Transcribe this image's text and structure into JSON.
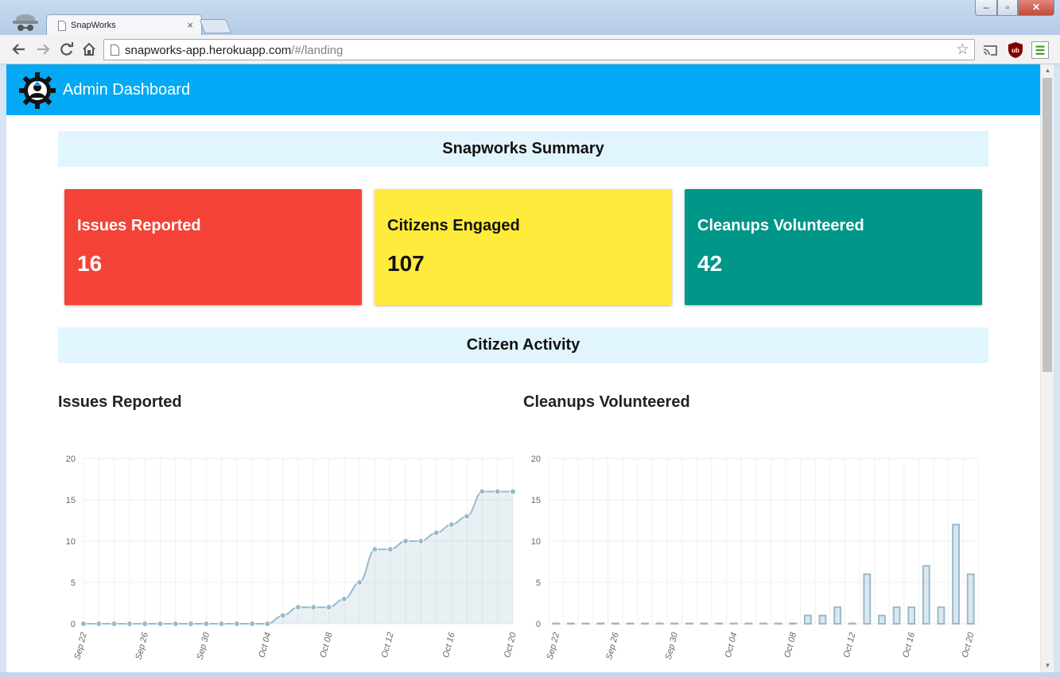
{
  "browser": {
    "tab_title": "SnapWorks",
    "tab_close": "×",
    "url_host": "snapworks-app.herokuapp.com",
    "url_path": "/#/landing",
    "nav_icons": [
      "back-icon",
      "forward-icon",
      "reload-icon",
      "home-icon"
    ],
    "extension_icons": [
      "cast-icon",
      "ublock-icon",
      "menu-icon"
    ]
  },
  "header": {
    "title": "Admin Dashboard",
    "bg_color": "#03a9f4"
  },
  "summary": {
    "heading": "Snapworks Summary",
    "cards": [
      {
        "label": "Issues Reported",
        "value": "16",
        "bg": "#f44336",
        "fg": "#ffffff"
      },
      {
        "label": "Citizens Engaged",
        "value": "107",
        "bg": "#ffeb3b",
        "fg": "#111111"
      },
      {
        "label": "Cleanups Volunteered",
        "value": "42",
        "bg": "#009688",
        "fg": "#ffffff"
      }
    ]
  },
  "activity": {
    "heading": "Citizen Activity"
  },
  "chart_data": [
    {
      "type": "area",
      "title": "Issues Reported",
      "ylim": [
        0,
        20
      ],
      "yticks": [
        0,
        5,
        10,
        15,
        20
      ],
      "x": [
        "Sep 22",
        "Sep 23",
        "Sep 24",
        "Sep 25",
        "Sep 26",
        "Sep 27",
        "Sep 28",
        "Sep 29",
        "Sep 30",
        "Oct 01",
        "Oct 02",
        "Oct 03",
        "Oct 04",
        "Oct 05",
        "Oct 06",
        "Oct 07",
        "Oct 08",
        "Oct 09",
        "Oct 10",
        "Oct 11",
        "Oct 12",
        "Oct 13",
        "Oct 14",
        "Oct 15",
        "Oct 16",
        "Oct 17",
        "Oct 18",
        "Oct 19",
        "Oct 20"
      ],
      "xtick_labels": [
        "Sep 22",
        "Sep 26",
        "Sep 30",
        "Oct 04",
        "Oct 08",
        "Oct 12",
        "Oct 16",
        "Oct 20"
      ],
      "values": [
        0,
        0,
        0,
        0,
        0,
        0,
        0,
        0,
        0,
        0,
        0,
        0,
        0,
        1,
        2,
        2,
        2,
        3,
        5,
        9,
        9,
        10,
        10,
        11,
        12,
        13,
        16,
        16,
        16
      ],
      "grid": true,
      "color": "#97bbcd"
    },
    {
      "type": "bar",
      "title": "Cleanups Volunteered",
      "ylim": [
        0,
        20
      ],
      "yticks": [
        0,
        5,
        10,
        15,
        20
      ],
      "x": [
        "Sep 22",
        "Sep 23",
        "Sep 24",
        "Sep 25",
        "Sep 26",
        "Sep 27",
        "Sep 28",
        "Sep 29",
        "Sep 30",
        "Oct 01",
        "Oct 02",
        "Oct 03",
        "Oct 04",
        "Oct 05",
        "Oct 06",
        "Oct 07",
        "Oct 08",
        "Oct 09",
        "Oct 10",
        "Oct 11",
        "Oct 12",
        "Oct 13",
        "Oct 14",
        "Oct 15",
        "Oct 16",
        "Oct 17",
        "Oct 18",
        "Oct 19",
        "Oct 20"
      ],
      "xtick_labels": [
        "Sep 22",
        "Sep 26",
        "Sep 30",
        "Oct 04",
        "Oct 08",
        "Oct 12",
        "Oct 16",
        "Oct 20"
      ],
      "values": [
        0,
        0,
        0,
        0,
        0,
        0,
        0,
        0,
        0,
        0,
        0,
        0,
        0,
        0,
        0,
        0,
        0,
        1,
        1,
        2,
        0,
        6,
        1,
        2,
        2,
        7,
        2,
        12,
        6
      ],
      "grid": true,
      "color": "#97bbcd"
    }
  ]
}
